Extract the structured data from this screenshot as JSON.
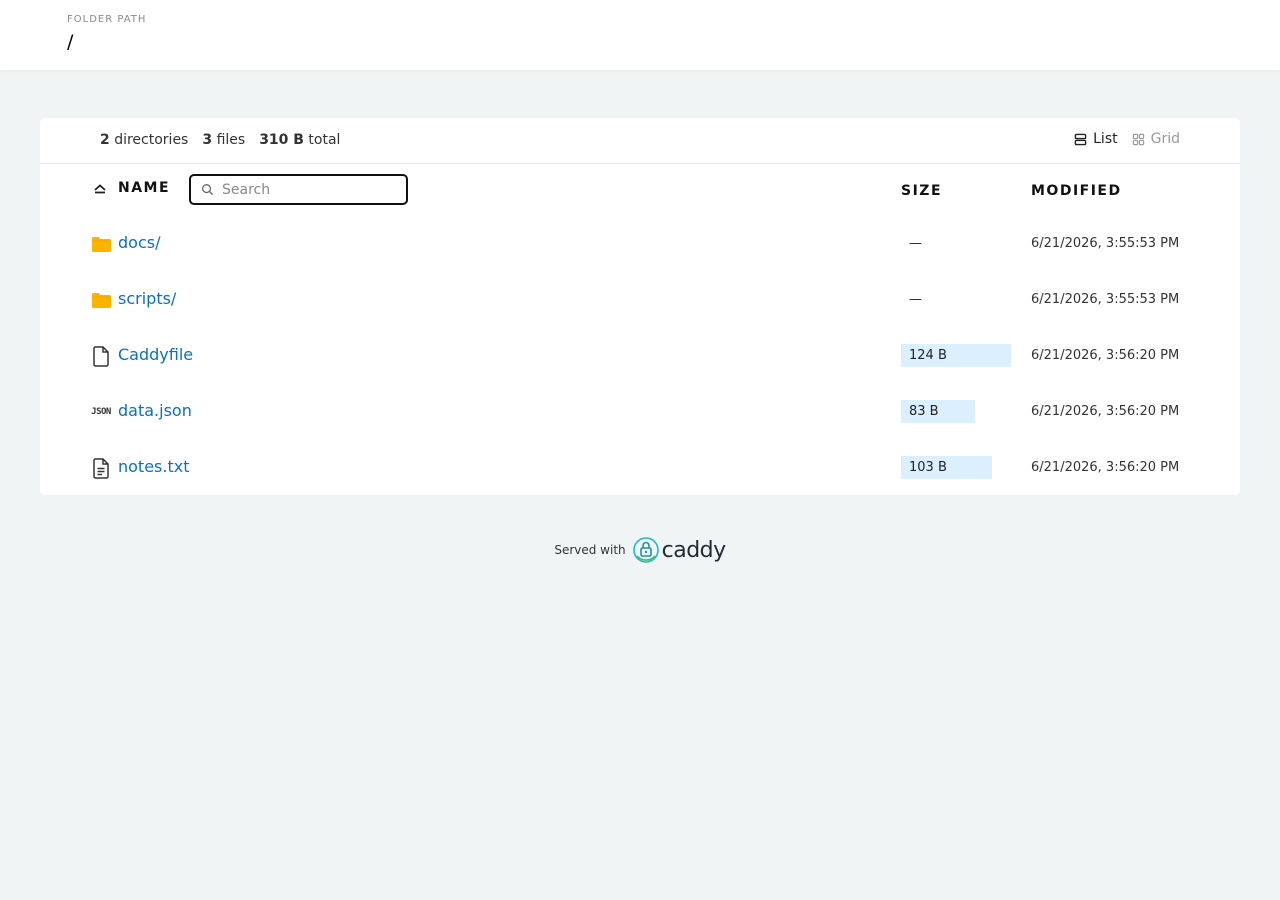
{
  "header": {
    "label": "FOLDER PATH",
    "path": "/"
  },
  "summary": {
    "directories_count": "2",
    "directories_label": "directories",
    "files_count": "3",
    "files_label": "files",
    "total_size": "310 B",
    "total_label": "total"
  },
  "layout": {
    "list_label": "List",
    "grid_label": "Grid",
    "active": "list"
  },
  "table": {
    "name_header": "NAME",
    "size_header": "SIZE",
    "modified_header": "MODIFIED",
    "search_placeholder": "Search",
    "search_value": "",
    "sort_order": "ascending",
    "rows": [
      {
        "name": "docs/",
        "icon": "folder-icon",
        "size": "—",
        "size_fraction": null,
        "modified": "6/21/2026, 3:55:53 PM"
      },
      {
        "name": "scripts/",
        "icon": "folder-icon",
        "size": "—",
        "size_fraction": null,
        "modified": "6/21/2026, 3:55:53 PM"
      },
      {
        "name": "Caddyfile",
        "icon": "file-icon",
        "size": "124 B",
        "size_fraction": 1.0,
        "modified": "6/21/2026, 3:56:20 PM"
      },
      {
        "name": "data.json",
        "icon": "json-icon",
        "size": "83 B",
        "size_fraction": 0.67,
        "modified": "6/21/2026, 3:56:20 PM"
      },
      {
        "name": "notes.txt",
        "icon": "text-file-icon",
        "size": "103 B",
        "size_fraction": 0.83,
        "modified": "6/21/2026, 3:56:20 PM"
      }
    ]
  },
  "footer": {
    "served_with": "Served with",
    "brand": "caddy"
  },
  "colors": {
    "background": "#f1f4f5",
    "link": "#0b6fc2",
    "folder": "#f9b400",
    "size_bar": "#dcefff"
  }
}
